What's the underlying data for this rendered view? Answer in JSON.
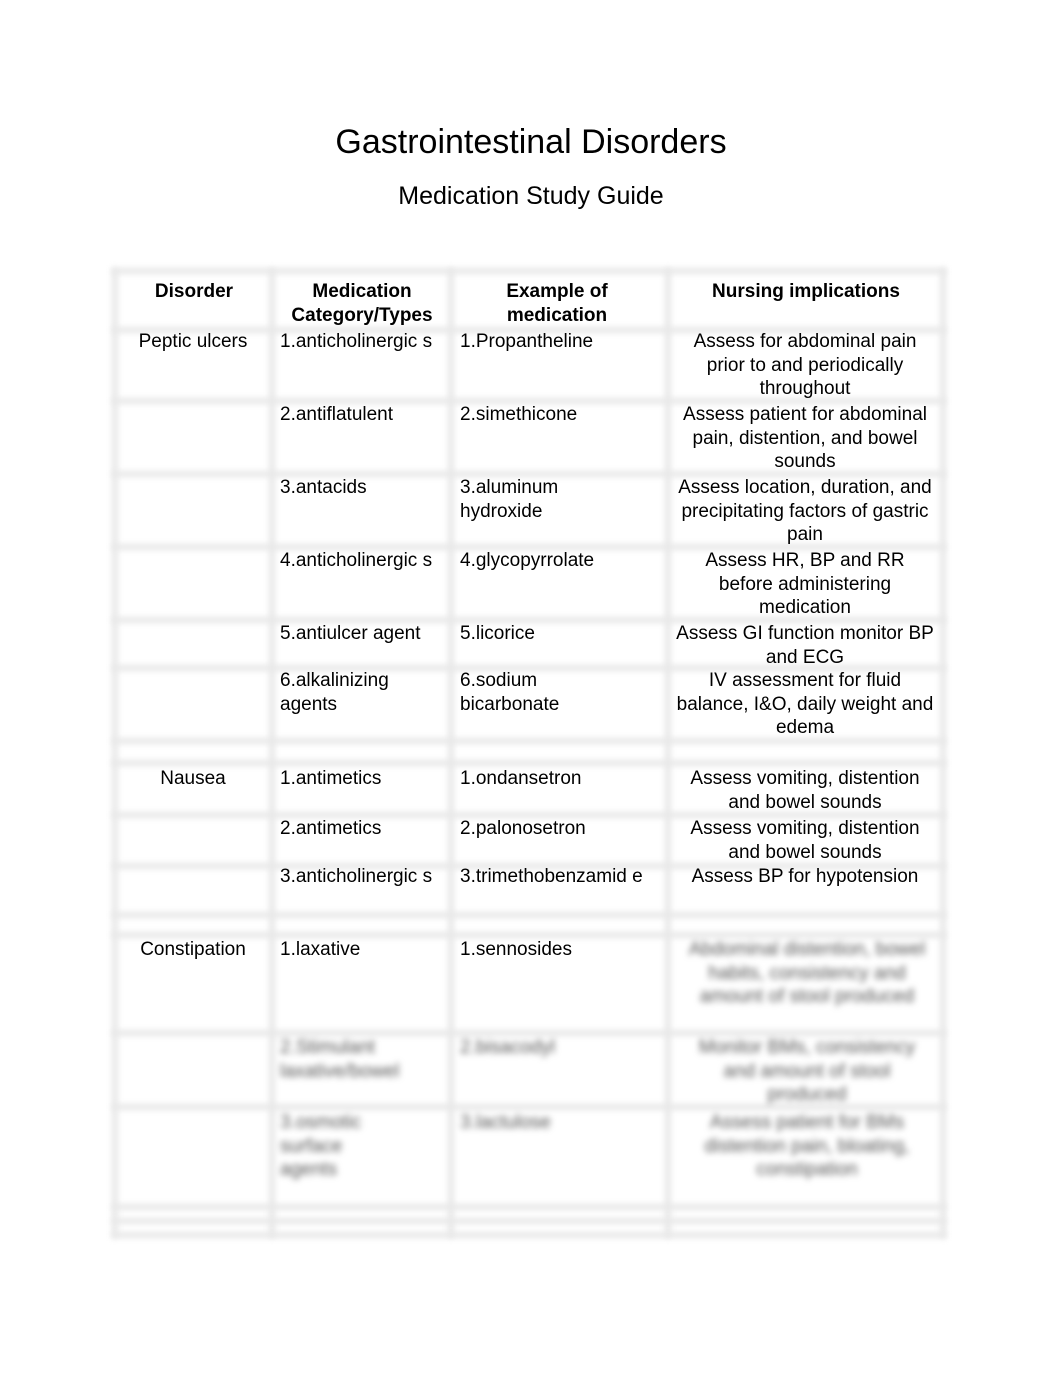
{
  "document": {
    "title": "Gastrointestinal Disorders",
    "subtitle": "Medication Study Guide"
  },
  "table": {
    "headers": [
      "Disorder",
      "Medication Category/Types",
      "Example of medication",
      "Nursing implications"
    ],
    "rows": [
      {
        "disorder": "Peptic ulcers",
        "category": "1.anticholinergic s",
        "example": "1.Propantheline",
        "implication": "Assess for abdominal pain prior to and periodically throughout"
      },
      {
        "disorder": "",
        "category": "2.antiflatulent",
        "example": "2.simethicone",
        "implication": "Assess patient for abdominal pain, distention, and bowel sounds"
      },
      {
        "disorder": "",
        "category": "3.antacids",
        "example": "3.aluminum hydroxide",
        "implication": "Assess location, duration, and precipitating factors of gastric pain"
      },
      {
        "disorder": "",
        "category": "4.anticholinergic s",
        "example": "4.glycopyrrolate",
        "implication": "Assess HR, BP and RR before administering medication"
      },
      {
        "disorder": "",
        "category": "5.antiulcer agent",
        "example": "5.licorice",
        "implication": "Assess GI function monitor BP and ECG"
      },
      {
        "disorder": "",
        "category": "6.alkalinizing agents",
        "example": "6.sodium bicarbonate",
        "implication": "IV assessment for fluid balance, I&O, daily weight and edema"
      },
      {
        "disorder": "",
        "category": "",
        "example": "",
        "implication": ""
      },
      {
        "disorder": "Nausea",
        "category": "1.antimetics",
        "example": "1.ondansetron",
        "implication": "Assess vomiting, distention and bowel sounds"
      },
      {
        "disorder": "",
        "category": "2.antimetics",
        "example": "2.palonosetron",
        "implication": "Assess vomiting, distention and bowel sounds"
      },
      {
        "disorder": "",
        "category": "3.anticholinergic s",
        "example": "3.trimethobenzamid e",
        "implication": "Assess BP for hypotension"
      },
      {
        "disorder": "",
        "category": "",
        "example": "",
        "implication": ""
      },
      {
        "disorder": "Constipation",
        "category": "1.laxative",
        "example": "1.sennosides",
        "implication": "[blurred text]"
      },
      {
        "disorder": "",
        "category": "[blurred text]",
        "example": "[blurred text]",
        "implication": "[blurred text]"
      },
      {
        "disorder": "",
        "category": "[blurred text]",
        "example": "[blurred text]",
        "implication": "[blurred text]"
      },
      {
        "disorder": "",
        "category": "",
        "example": "",
        "implication": ""
      }
    ]
  },
  "blurred_placeholders": {
    "r11_impl": "Abdominal distention, bowel habits, consistency and amount of stool produced",
    "r12_cat": "2.Stimulant laxative/bowel",
    "r12_ex": "2.bisacodyl",
    "r12_impl": "Monitor BMs, consistency and amount of stool produced",
    "r13_cat": "3.osmotic surface agents",
    "r13_ex": "3.lactulose",
    "r13_impl": "Assess patient for BMs distention pain, bloating, constipation"
  }
}
